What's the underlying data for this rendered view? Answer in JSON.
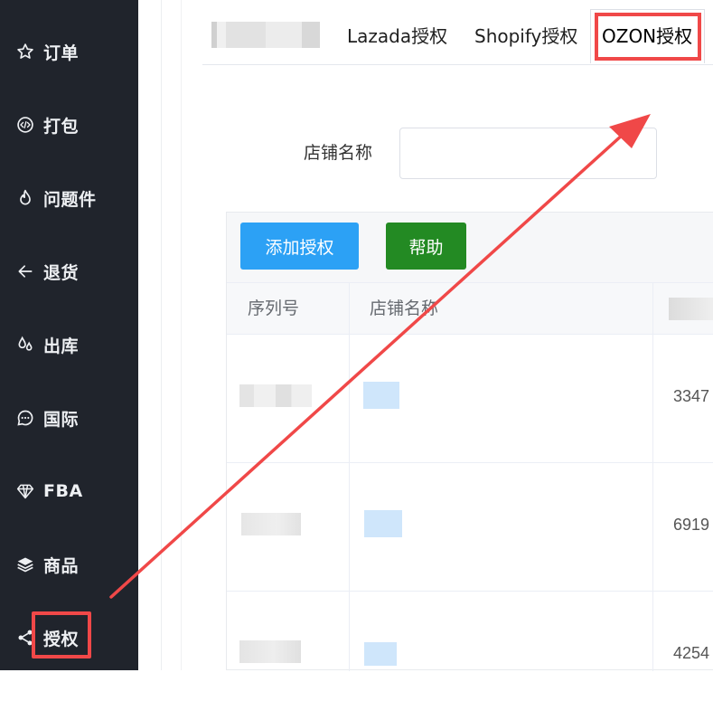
{
  "sidebar": {
    "items": [
      {
        "label": "订单",
        "icon": "star-icon"
      },
      {
        "label": "打包",
        "icon": "code-circle-icon"
      },
      {
        "label": "问题件",
        "icon": "flame-icon"
      },
      {
        "label": "退货",
        "icon": "arrow-left-icon"
      },
      {
        "label": "出库",
        "icon": "drops-icon"
      },
      {
        "label": "国际",
        "icon": "chat-dots-icon"
      },
      {
        "label": "FBA",
        "icon": "diamond-icon"
      },
      {
        "label": "商品",
        "icon": "layers-icon"
      },
      {
        "label": "授权",
        "icon": "share-icon"
      }
    ],
    "active_index": 8
  },
  "tabs": {
    "items": [
      "Lazada授权",
      "Shopify授权"
    ],
    "active_label": "OZON授权"
  },
  "form": {
    "shop_name_label": "店铺名称",
    "shop_name_value": ""
  },
  "toolbar": {
    "add_label": "添加授权",
    "help_label": "帮助"
  },
  "table": {
    "headers": [
      "序列号",
      "店铺名称"
    ],
    "rows": [
      {
        "id_partial": "3347"
      },
      {
        "id_partial": "6919"
      },
      {
        "id_partial": "4254"
      }
    ]
  },
  "colors": {
    "sidebar_bg": "#20242c",
    "highlight_red": "#f04848",
    "add_button": "#2ca1f5",
    "help_button": "#238a23"
  }
}
